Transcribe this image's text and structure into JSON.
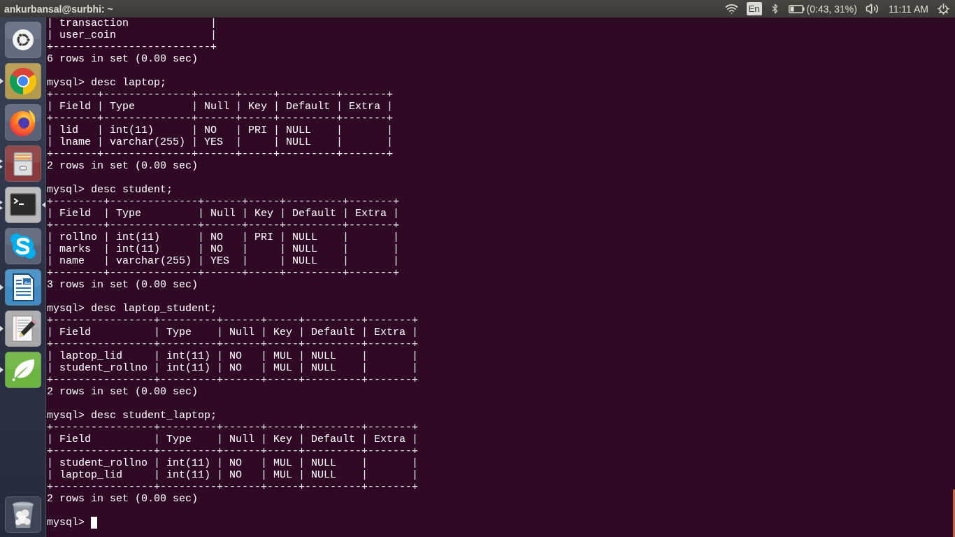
{
  "top_bar": {
    "title": "ankurbansal@surbhi: ~",
    "keyboard_layout": "En",
    "battery_status": "(0:43, 31%)",
    "clock": "11:11 AM"
  },
  "launcher": {
    "items": [
      {
        "running": false,
        "second_window": false,
        "focused": false
      },
      {
        "running": true,
        "second_window": false,
        "focused": false
      },
      {
        "running": false,
        "second_window": false,
        "focused": false
      },
      {
        "running": true,
        "second_window": true,
        "focused": false
      },
      {
        "running": true,
        "second_window": true,
        "focused": true
      },
      {
        "running": false,
        "second_window": false,
        "focused": false
      },
      {
        "running": true,
        "second_window": false,
        "focused": false
      },
      {
        "running": true,
        "second_window": false,
        "focused": false
      },
      {
        "running": true,
        "second_window": false,
        "focused": false
      }
    ]
  },
  "terminal": {
    "blocks": [
      {
        "output": [
          "| transaction             |",
          "| user_coin               |",
          "+-------------------------+",
          "6 rows in set (0.00 sec)"
        ]
      },
      {
        "command": "mysql> desc laptop;",
        "output": [
          "+-------+--------------+------+-----+---------+-------+",
          "| Field | Type         | Null | Key | Default | Extra |",
          "+-------+--------------+------+-----+---------+-------+",
          "| lid   | int(11)      | NO   | PRI | NULL    |       |",
          "| lname | varchar(255) | YES  |     | NULL    |       |",
          "+-------+--------------+------+-----+---------+-------+",
          "2 rows in set (0.00 sec)"
        ]
      },
      {
        "command": "mysql> desc student;",
        "output": [
          "+--------+--------------+------+-----+---------+-------+",
          "| Field  | Type         | Null | Key | Default | Extra |",
          "+--------+--------------+------+-----+---------+-------+",
          "| rollno | int(11)      | NO   | PRI | NULL    |       |",
          "| marks  | int(11)      | NO   |     | NULL    |       |",
          "| name   | varchar(255) | YES  |     | NULL    |       |",
          "+--------+--------------+------+-----+---------+-------+",
          "3 rows in set (0.00 sec)"
        ]
      },
      {
        "command": "mysql> desc laptop_student;",
        "output": [
          "+----------------+---------+------+-----+---------+-------+",
          "| Field          | Type    | Null | Key | Default | Extra |",
          "+----------------+---------+------+-----+---------+-------+",
          "| laptop_lid     | int(11) | NO   | MUL | NULL    |       |",
          "| student_rollno | int(11) | NO   | MUL | NULL    |       |",
          "+----------------+---------+------+-----+---------+-------+",
          "2 rows in set (0.00 sec)"
        ]
      },
      {
        "command": "mysql> desc student_laptop;",
        "output": [
          "+----------------+---------+------+-----+---------+-------+",
          "| Field          | Type    | Null | Key | Default | Extra |",
          "+----------------+---------+------+-----+---------+-------+",
          "| student_rollno | int(11) | NO   | MUL | NULL    |       |",
          "| laptop_lid     | int(11) | NO   | MUL | NULL    |       |",
          "+----------------+---------+------+-----+---------+-------+",
          "2 rows in set (0.00 sec)"
        ]
      }
    ],
    "prompt": "mysql>"
  }
}
